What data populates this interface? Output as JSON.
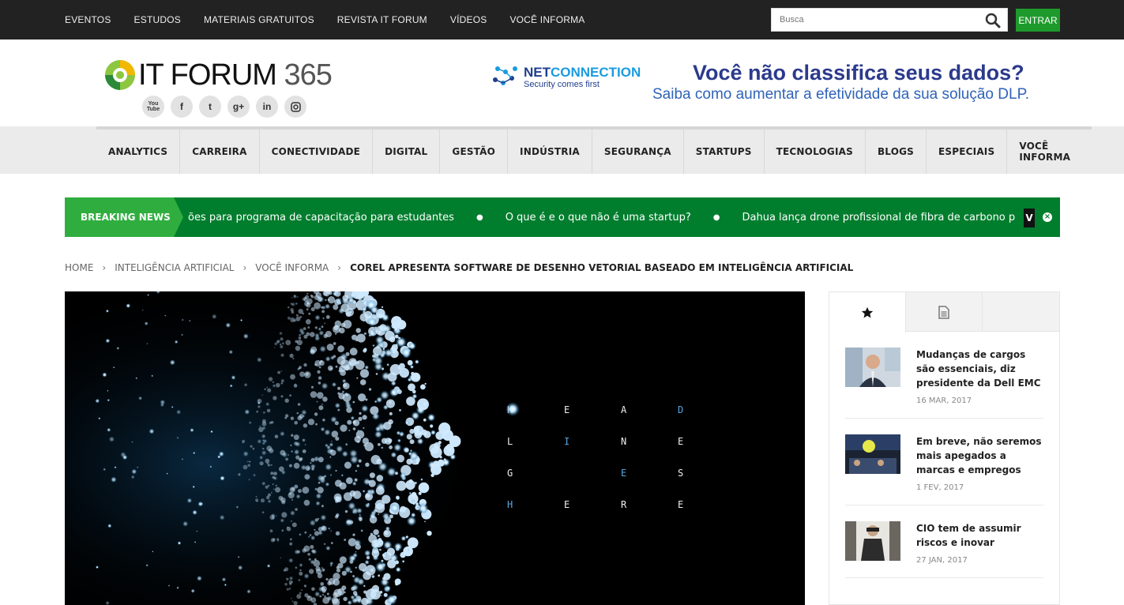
{
  "topnav": [
    "EVENTOS",
    "ESTUDOS",
    "MATERIAIS GRATUITOS",
    "REVISTA IT FORUM",
    "VÍDEOS",
    "VOCÊ INFORMA"
  ],
  "search": {
    "placeholder": "Busca"
  },
  "login_label": "ENTRAR",
  "logo": {
    "text": "IT FORUM",
    "number": "365"
  },
  "social": [
    "You Tube",
    "f",
    "t",
    "g+",
    "in",
    "ig"
  ],
  "ad": {
    "brand_net": "NET",
    "brand_connection": "CONNECTION",
    "brand_tagline": "Security comes first",
    "headline": "Você não classifica seus dados?",
    "subline": "Saiba como aumentar a efetividade da sua solução DLP."
  },
  "mainnav": [
    "ANALYTICS",
    "CARREIRA",
    "CONECTIVIDADE",
    "DIGITAL",
    "GESTÃO",
    "INDÚSTRIA",
    "SEGURANÇA",
    "STARTUPS",
    "TECNOLOGIAS",
    "BLOGS",
    "ESPECIAIS",
    "VOCÊ INFORMA"
  ],
  "breaking": {
    "label": "BREAKING NEWS",
    "items": [
      "ões para programa de capacitação para estudantes",
      "O que é e o que não é uma startup?",
      "Dahua lança drone profissional de fibra de carbono para áreas extremas"
    ],
    "stub": "V",
    "close": "×"
  },
  "breadcrumb": {
    "home": "HOME",
    "cat1": "INTELIGÊNCIA ARTIFICIAL",
    "cat2": "VOCÊ INFORMA",
    "current": "COREL APRESENTA SOFTWARE DE DESENHO VETORIAL BASEADO EM INTELIGÊNCIA ARTIFICIAL"
  },
  "hero_letters": [
    [
      "H",
      "E",
      "A",
      "D"
    ],
    [
      "L",
      "I",
      "N",
      "E"
    ],
    [
      "G",
      "",
      "E",
      "S"
    ],
    [
      "H",
      "E",
      "R",
      "E"
    ]
  ],
  "sidebar": {
    "posts": [
      {
        "title": "Mudanças de cargos são essenciais, diz presidente da Dell EMC",
        "date": "16 MAR, 2017"
      },
      {
        "title": "Em breve, não seremos mais apegados a marcas e empregos",
        "date": "1 FEV, 2017"
      },
      {
        "title": "CIO tem de assumir riscos e inovar",
        "date": "27 JAN, 2017"
      }
    ]
  },
  "colors": {
    "topbar": "#222222",
    "accent_green": "#1e9a2c",
    "ticker_green": "#007e2d",
    "ad_navy": "#2b3a8c"
  }
}
